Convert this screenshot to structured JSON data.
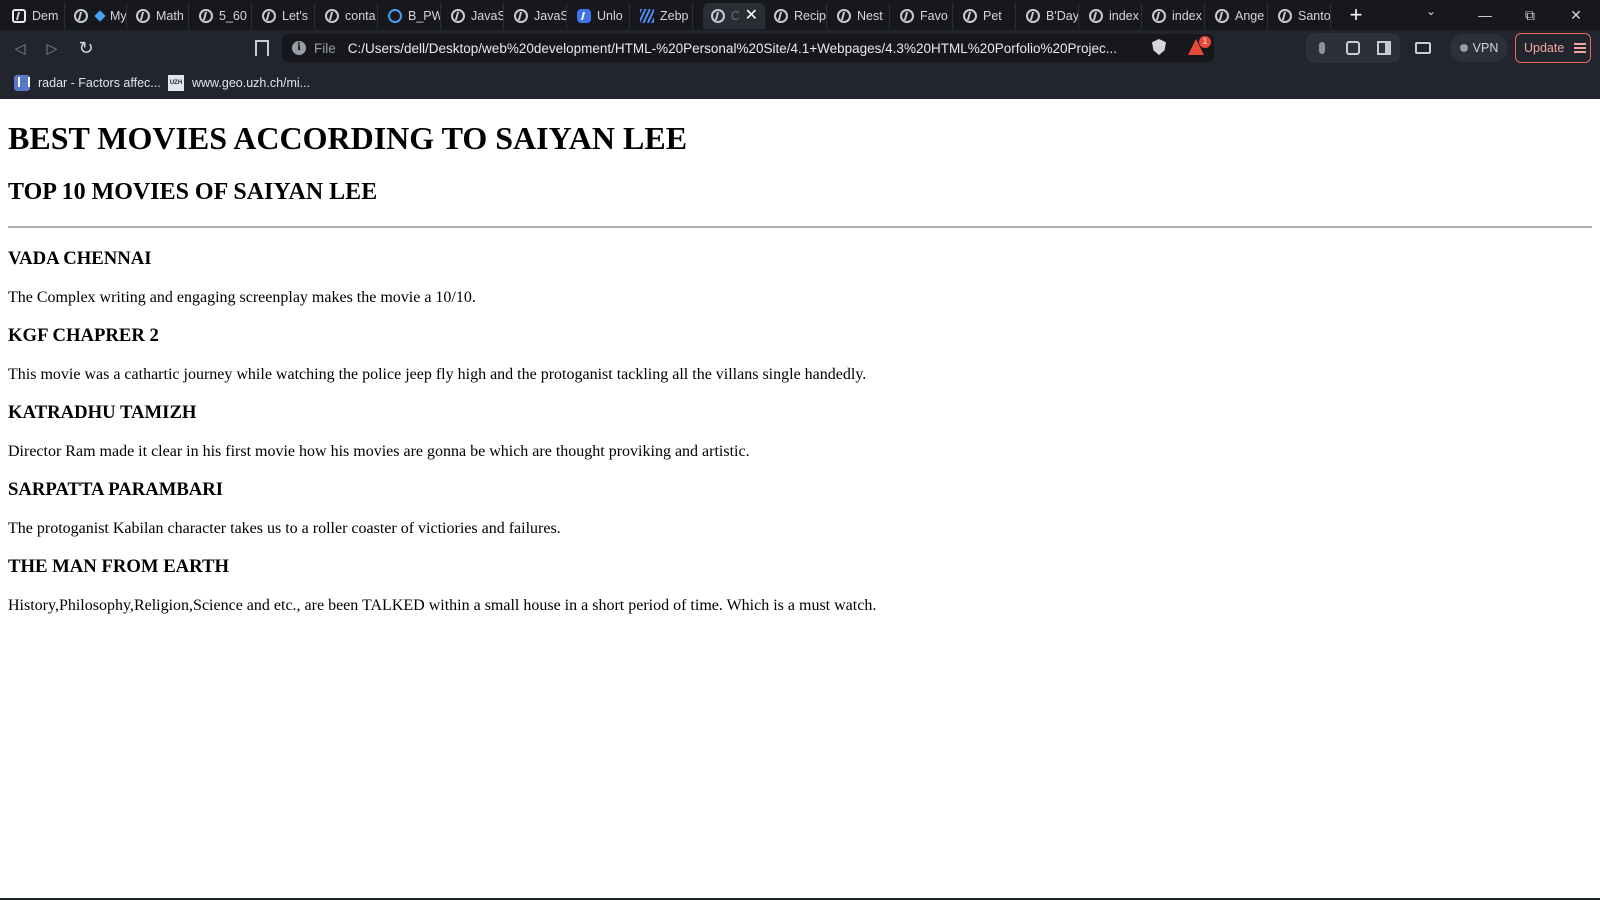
{
  "browser": {
    "tabs": [
      {
        "label": "Dem",
        "icon": "brave-icon"
      },
      {
        "label": "My",
        "icon": "diamond-icon"
      },
      {
        "label": "Math",
        "icon": "globe-icon"
      },
      {
        "label": "5_60",
        "icon": "globe-icon"
      },
      {
        "label": "Let's",
        "icon": "globe-icon"
      },
      {
        "label": "conta",
        "icon": "globe-icon"
      },
      {
        "label": "B_PW",
        "icon": "ring-icon"
      },
      {
        "label": "JavaS",
        "icon": "globe-icon"
      },
      {
        "label": "JavaS",
        "icon": "globe-icon"
      },
      {
        "label": "Unlo",
        "icon": "app-icon"
      },
      {
        "label": "Zebp",
        "icon": "zebra-icon"
      },
      {
        "label": "C",
        "icon": "globe-icon",
        "active": true
      },
      {
        "label": "Recip",
        "icon": "globe-icon"
      },
      {
        "label": "Nest",
        "icon": "globe-icon"
      },
      {
        "label": "Favo",
        "icon": "globe-icon"
      },
      {
        "label": "Pet",
        "icon": "globe-icon"
      },
      {
        "label": "B'Day",
        "icon": "globe-icon"
      },
      {
        "label": "index",
        "icon": "globe-icon"
      },
      {
        "label": "index",
        "icon": "globe-icon"
      },
      {
        "label": "Ange",
        "icon": "globe-icon"
      },
      {
        "label": "Santo",
        "icon": "globe-icon"
      }
    ],
    "close_glyph": "✕",
    "new_tab_glyph": "+",
    "url_scheme": "File",
    "url": "C:/Users/dell/Desktop/web%20development/HTML-%20Personal%20Site/4.1+Webpages/4.3%20HTML%20Porfolio%20Projec...",
    "rewards_badge_count": "1",
    "vpn_label": "VPN",
    "update_label": "Update",
    "bookmarks": [
      {
        "label": "radar - Factors affec...",
        "icon": "site-icon"
      },
      {
        "label": "www.geo.uzh.ch/mi...",
        "icon": "uzh-icon"
      }
    ],
    "uzh_icon_text": "UZH"
  },
  "page": {
    "title": "BEST MOVIES ACCORDING TO SAIYAN LEE",
    "subtitle": "TOP 10 MOVIES OF SAIYAN LEE",
    "movies": [
      {
        "name": "VADA CHENNAI",
        "review": "The Complex writing and engaging screenplay makes the movie a 10/10."
      },
      {
        "name": "KGF CHAPRER 2",
        "review": "This movie was a cathartic journey while watching the police jeep fly high and the protoganist tackling all the villans single handedly."
      },
      {
        "name": "KATRADHU TAMIZH",
        "review": "Director Ram made it clear in his first movie how his movies are gonna be which are thought proviking and artistic."
      },
      {
        "name": "SARPATTA PARAMBARI",
        "review": "The protoganist Kabilan character takes us to a roller coaster of victiories and failures."
      },
      {
        "name": "THE MAN FROM EARTH",
        "review": "History,Philosophy,Religion,Science and etc., are been TALKED within a small house in a short period of time. Which is a must watch."
      }
    ]
  }
}
